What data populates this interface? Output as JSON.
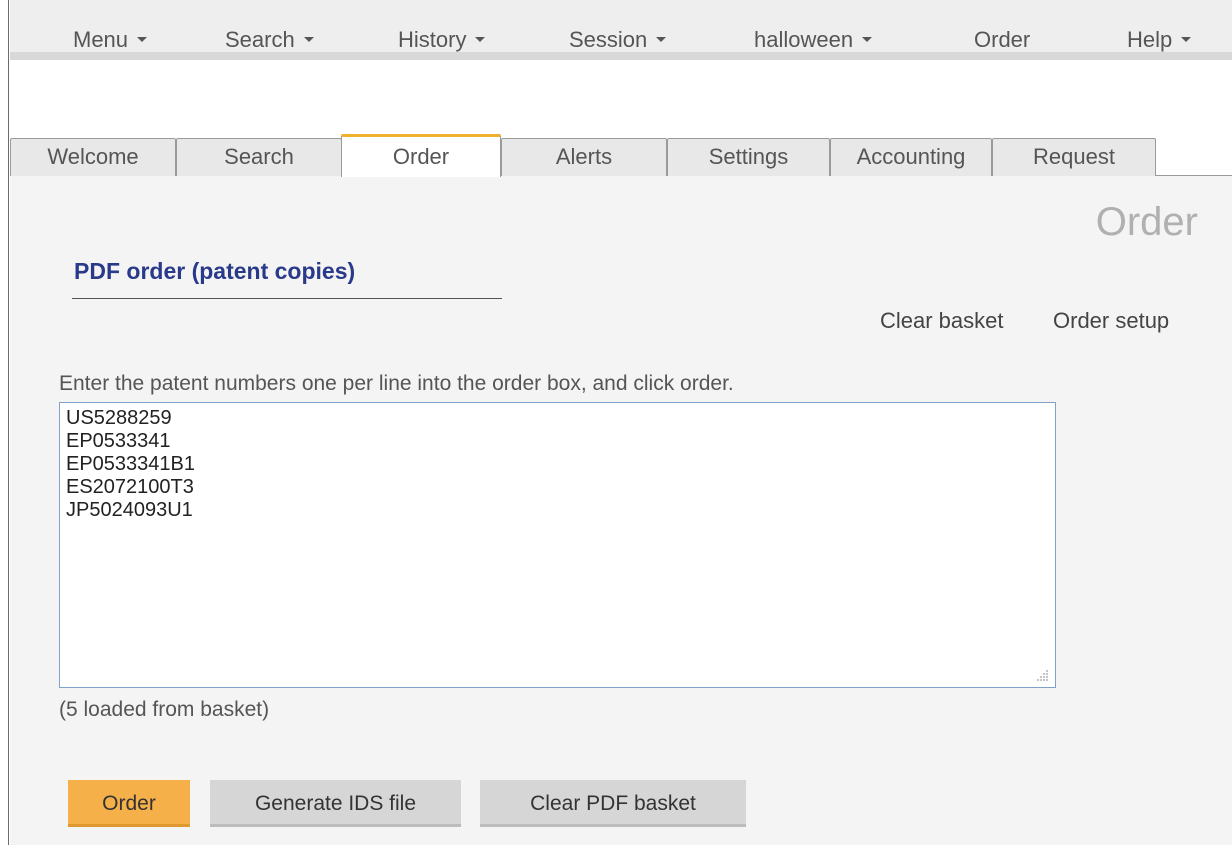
{
  "menubar": {
    "items": [
      {
        "label": "Menu",
        "dropdown": true
      },
      {
        "label": "Search",
        "dropdown": true
      },
      {
        "label": "History",
        "dropdown": true
      },
      {
        "label": "Session",
        "dropdown": true
      },
      {
        "label": "halloween",
        "dropdown": true
      },
      {
        "label": "Order",
        "dropdown": false
      },
      {
        "label": "Help",
        "dropdown": true
      }
    ]
  },
  "tabs": [
    {
      "label": "Welcome",
      "active": false
    },
    {
      "label": "Search",
      "active": false
    },
    {
      "label": "Order",
      "active": true
    },
    {
      "label": "Alerts",
      "active": false
    },
    {
      "label": "Settings",
      "active": false
    },
    {
      "label": "Accounting",
      "active": false
    },
    {
      "label": "Request",
      "active": false
    }
  ],
  "page": {
    "heading": "Order",
    "section_title": "PDF order (patent copies)",
    "links": {
      "clear_basket": "Clear basket",
      "order_setup": "Order setup"
    },
    "instructions": "Enter the patent numbers one per line into the order box, and click order.",
    "order_lines": [
      "US5288259",
      "EP0533341",
      "EP0533341B1",
      "ES2072100T3",
      "JP5024093U1"
    ],
    "loaded_note": "(5 loaded from basket)"
  },
  "buttons": {
    "order": "Order",
    "generate_ids": "Generate IDS file",
    "clear_pdf_basket": "Clear PDF basket"
  },
  "colors": {
    "accent_orange": "#f5b04a",
    "section_title_blue": "#2a3a8a",
    "tab_active_border": "#f0b030"
  },
  "icons": {
    "dropdown": "caret-down-icon",
    "resize": "resize-grip-icon"
  }
}
